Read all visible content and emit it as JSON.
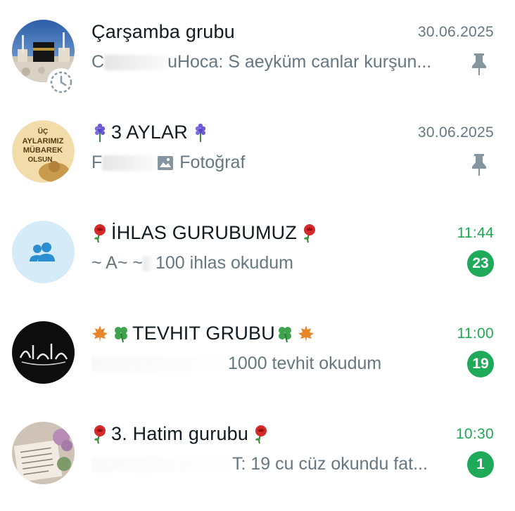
{
  "chats": [
    {
      "title": "Çarşamba grubu",
      "time": "30.06.2025",
      "preview_prefix": "C",
      "preview": "uHoca: S aeyküm canlar kurşun...",
      "pinned": true,
      "unread": null,
      "avatar": "kaaba-photo"
    },
    {
      "title": "3 AYLAR",
      "time": "30.06.2025",
      "preview_prefix": "F",
      "preview": "Fotoğraf",
      "pinned": true,
      "unread": null,
      "avatar": "uc-aylar-image",
      "avatar_text": [
        "ÜÇ",
        "AYLARIMIZ",
        "MÜBAREK",
        "OLSUN"
      ]
    },
    {
      "title": "İHLAS GURUBUMUZ",
      "time": "11:44",
      "preview_prefix": "~ A~ ~",
      "preview": "100 ihlas okudum",
      "pinned": false,
      "unread": "23",
      "avatar": "group-placeholder"
    },
    {
      "title": "TEVHIT GRUBU",
      "time": "11:00",
      "preview_prefix": "",
      "preview": "1000 tevhit okudum",
      "pinned": false,
      "unread": "19",
      "avatar": "calligraphy-photo"
    },
    {
      "title": "3. Hatim gurubu",
      "time": "10:30",
      "preview_prefix": "",
      "preview": "T: 19 cu cüz okundu fat...",
      "pinned": false,
      "unread": "1",
      "avatar": "quran-photo"
    }
  ],
  "colors": {
    "title": "#111b21",
    "secondary": "#667781",
    "accent_green": "#1faa59",
    "avatar_placeholder_bg": "#d5ecf8",
    "avatar_placeholder_icon": "#2a8ed1"
  }
}
